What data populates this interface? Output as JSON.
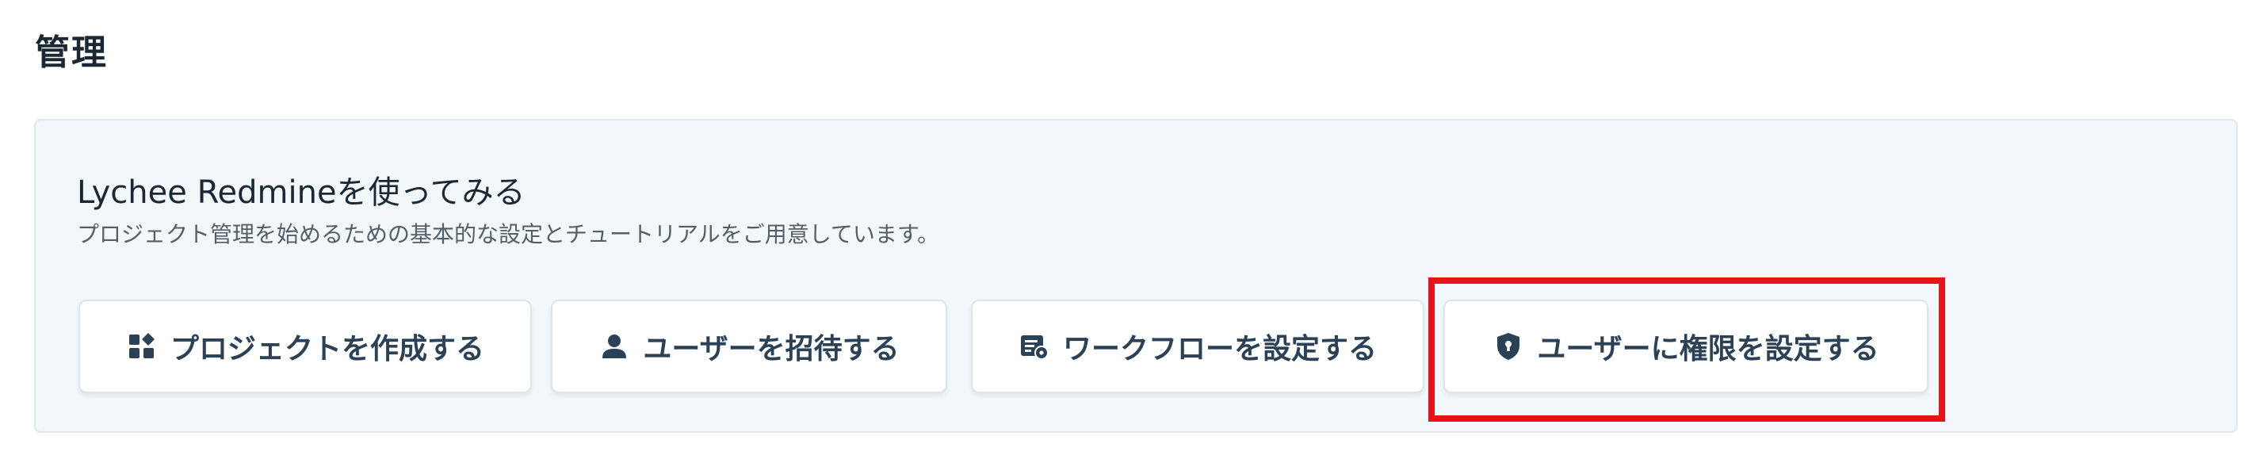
{
  "page": {
    "title": "管理"
  },
  "panel": {
    "title": "Lychee Redmineを使ってみる",
    "description": "プロジェクト管理を始めるための基本的な設定とチュートリアルをご用意しています。",
    "buttons": [
      {
        "label": "プロジェクトを作成する",
        "icon": "project-grid-icon"
      },
      {
        "label": "ユーザーを招待する",
        "icon": "user-icon"
      },
      {
        "label": "ワークフローを設定する",
        "icon": "workflow-settings-icon"
      },
      {
        "label": "ユーザーに権限を設定する",
        "icon": "shield-icon"
      }
    ]
  },
  "highlight": {
    "color": "#e8121b",
    "target": "ユーザーに権限を設定する"
  },
  "colors": {
    "panel_background": "#f2f7f9",
    "button_text": "#2b4156",
    "title_text": "#1b2733"
  }
}
